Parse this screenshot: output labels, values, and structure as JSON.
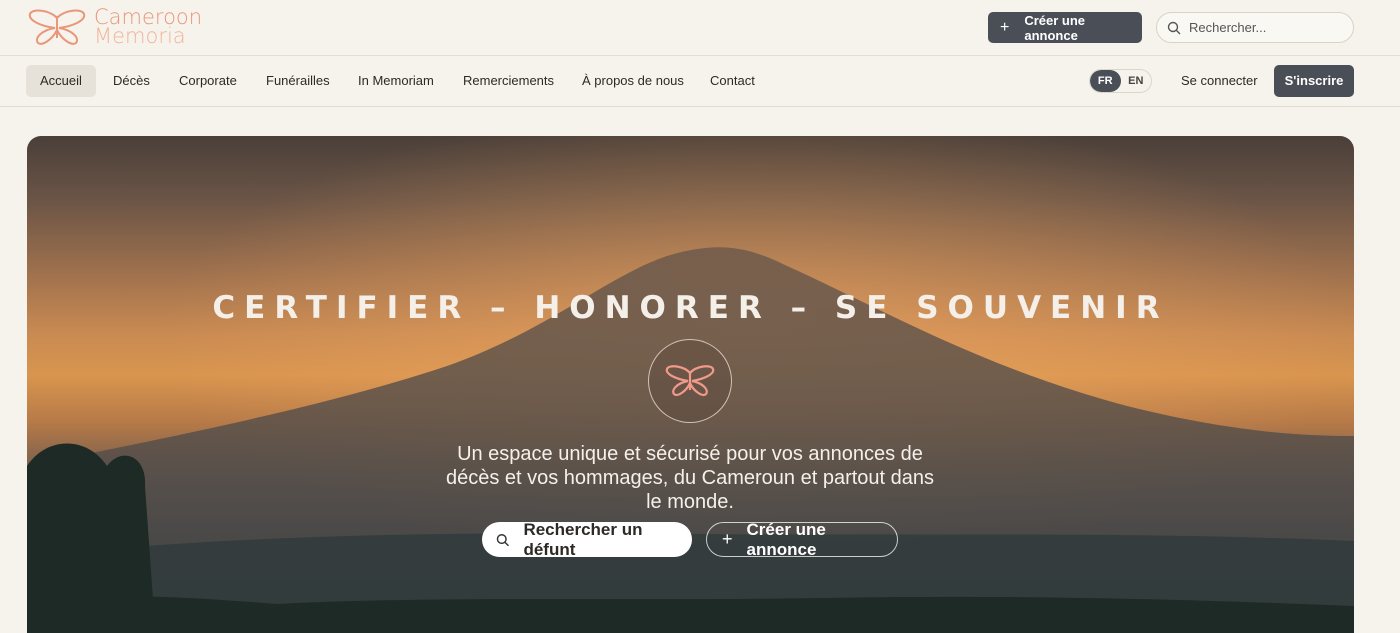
{
  "brand": {
    "line1": "Cameroon",
    "line2": "Memoria",
    "logo_icon": "butterfly-icon"
  },
  "header": {
    "create_button": "Créer une annonce",
    "search_placeholder": "Rechercher..."
  },
  "nav": {
    "items": [
      {
        "label": "Accueil",
        "active": true
      },
      {
        "label": "Décès"
      },
      {
        "label": "Corporate"
      },
      {
        "label": "Funérailles"
      },
      {
        "label": "In Memoriam"
      },
      {
        "label": "Remerciements"
      },
      {
        "label": "À propos de nous"
      },
      {
        "label": "Contact"
      }
    ],
    "lang": {
      "fr": "FR",
      "en": "EN",
      "selected": "FR"
    },
    "login": "Se connecter",
    "signup": "S'inscrire"
  },
  "hero": {
    "tagline": "CERTIFIER – HONORER – SE SOUVENIR",
    "description": "Un espace unique et sécurisé pour vos annonces de décès et vos hommages, du Cameroun et partout dans le monde.",
    "search_button": "Rechercher un défunt",
    "create_button": "Créer une annonce"
  },
  "colors": {
    "accent_dark": "#4a4f57",
    "brand_coral": "#e9967a",
    "background": "#f6f3ec"
  }
}
